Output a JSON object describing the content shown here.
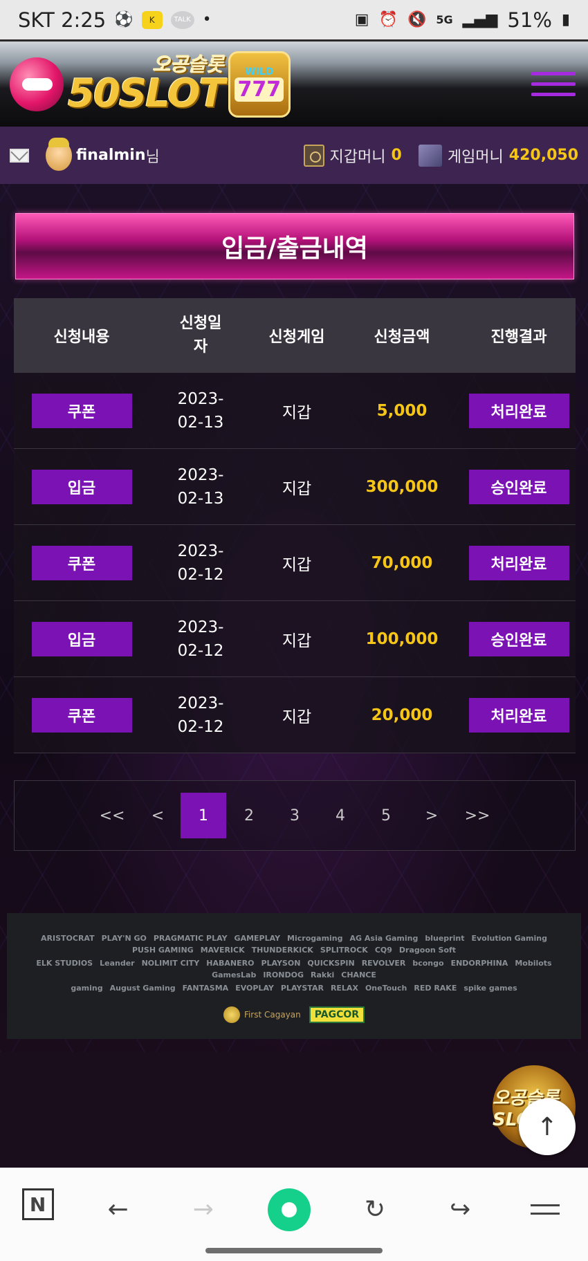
{
  "status_bar": {
    "carrier_time": "SKT 2:25",
    "kakao_label": "KAKAO",
    "talk_label": "TALK",
    "network": "5G",
    "battery": "51%"
  },
  "header": {
    "logo_korean": "오공슬롯",
    "logo_text": "50SLOT",
    "logo_badge_wild": "WILD",
    "logo_badge_sevens": "777"
  },
  "user_bar": {
    "username": "finalmin",
    "username_suffix": "님",
    "wallet_label": "지갑머니",
    "wallet_value": "0",
    "game_money_label": "게임머니",
    "game_money_value": "420,050"
  },
  "page": {
    "title": "입금/출금내역"
  },
  "table": {
    "headers": [
      "신청내용",
      "신청일\n자",
      "신청게임",
      "신청금액",
      "진행결과"
    ],
    "rows": [
      {
        "type": "쿠폰",
        "date_line1": "2023-",
        "date_line2": "02-13",
        "game": "지갑",
        "amount": "5,000",
        "result": "처리완료"
      },
      {
        "type": "입금",
        "date_line1": "2023-",
        "date_line2": "02-13",
        "game": "지갑",
        "amount": "300,000",
        "result": "승인완료"
      },
      {
        "type": "쿠폰",
        "date_line1": "2023-",
        "date_line2": "02-12",
        "game": "지갑",
        "amount": "70,000",
        "result": "처리완료"
      },
      {
        "type": "입금",
        "date_line1": "2023-",
        "date_line2": "02-12",
        "game": "지갑",
        "amount": "100,000",
        "result": "승인완료"
      },
      {
        "type": "쿠폰",
        "date_line1": "2023-",
        "date_line2": "02-12",
        "game": "지갑",
        "amount": "20,000",
        "result": "처리완료"
      }
    ]
  },
  "pagination": {
    "first": "<<",
    "prev": "<",
    "pages": [
      "1",
      "2",
      "3",
      "4",
      "5"
    ],
    "active_page": "1",
    "next": ">",
    "last": ">>"
  },
  "providers": {
    "row1": [
      "ARISTOCRAT",
      "PLAY'N GO",
      "PRAGMATIC PLAY",
      "GAMEPLAY",
      "Microgaming",
      "AG Asia Gaming",
      "blueprint",
      "Evolution Gaming",
      "PUSH GAMING",
      "MAVERICK",
      "THUNDERKICK",
      "SPLITROCK",
      "CQ9",
      "Dragoon Soft"
    ],
    "row2": [
      "ELK STUDIOS",
      "Leander",
      "NOLIMIT CITY",
      "HABANERO",
      "PLAYSON",
      "QUICKSPIN",
      "REVOLVER",
      "bcongo",
      "ENDORPHINA",
      "Mobilots",
      "GamesLab",
      "IRONDOG",
      "Rakki",
      "CHANCE"
    ],
    "row3": [
      "gaming",
      "August Gaming",
      "FANTASMA",
      "EVOPLAY",
      "PLAYSTAR",
      "RELAX",
      "OneTouch",
      "RED RAKE",
      "spike games"
    ],
    "cert_first_cagayan": "First Cagayan",
    "cert_pagcor": "PAGCOR"
  },
  "float": {
    "logo_text": "오공슬롯 SLOT",
    "top_button": "↑"
  },
  "browser_bar": {
    "n_label": "N",
    "back": "←",
    "forward": "→",
    "reload": "↻",
    "share": "↪"
  }
}
